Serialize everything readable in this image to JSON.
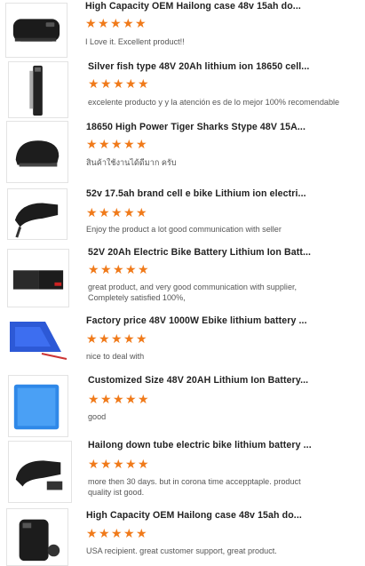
{
  "reviews": [
    {
      "title": "High Capacity OEM Hailong case 48v 15ah do...",
      "rating": 5,
      "comment": "I Love it. Excellent product!!",
      "icon": "battery-hailong-icon"
    },
    {
      "title": "Silver fish type 48V 20Ah lithium ion 18650 cell...",
      "rating": 5,
      "comment": "excelente producto y y la atención es de lo mejor 100% recomendable",
      "icon": "battery-silverfish-icon"
    },
    {
      "title": "18650 High Power Tiger Sharks Stype 48V 15A...",
      "rating": 5,
      "comment": "สินค้าใช้งานได้ดีมาก ครับ",
      "icon": "battery-tigershark-icon"
    },
    {
      "title": "52v 17.5ah brand cell e bike Lithium ion electri...",
      "rating": 5,
      "comment": "Enjoy the product a lot good communication with seller",
      "icon": "battery-tube-icon"
    },
    {
      "title": "52V 20Ah Electric Bike Battery Lithium Ion Batt...",
      "rating": 5,
      "comment": "great product, and very good communication with supplier, Completely satisfied 100%,",
      "icon": "battery-pair-icon"
    },
    {
      "title": "Factory price 48V 1000W Ebike lithium battery ...",
      "rating": 5,
      "comment": "nice to deal with",
      "icon": "battery-triangle-icon"
    },
    {
      "title": "Customized Size 48V 20AH Lithium Ion Battery...",
      "rating": 5,
      "comment": "good",
      "icon": "battery-pack-blue-icon"
    },
    {
      "title": "Hailong down tube electric bike lithium battery ...",
      "rating": 5,
      "comment": "more then 30 days. but in corona time accepptaple. product quality ist good.",
      "icon": "battery-downtube-icon"
    },
    {
      "title": "High Capacity OEM Hailong case 48v 15ah do...",
      "rating": 5,
      "comment": "USA recipient. great customer support, great product.",
      "icon": "battery-hailong-mount-icon"
    }
  ]
}
